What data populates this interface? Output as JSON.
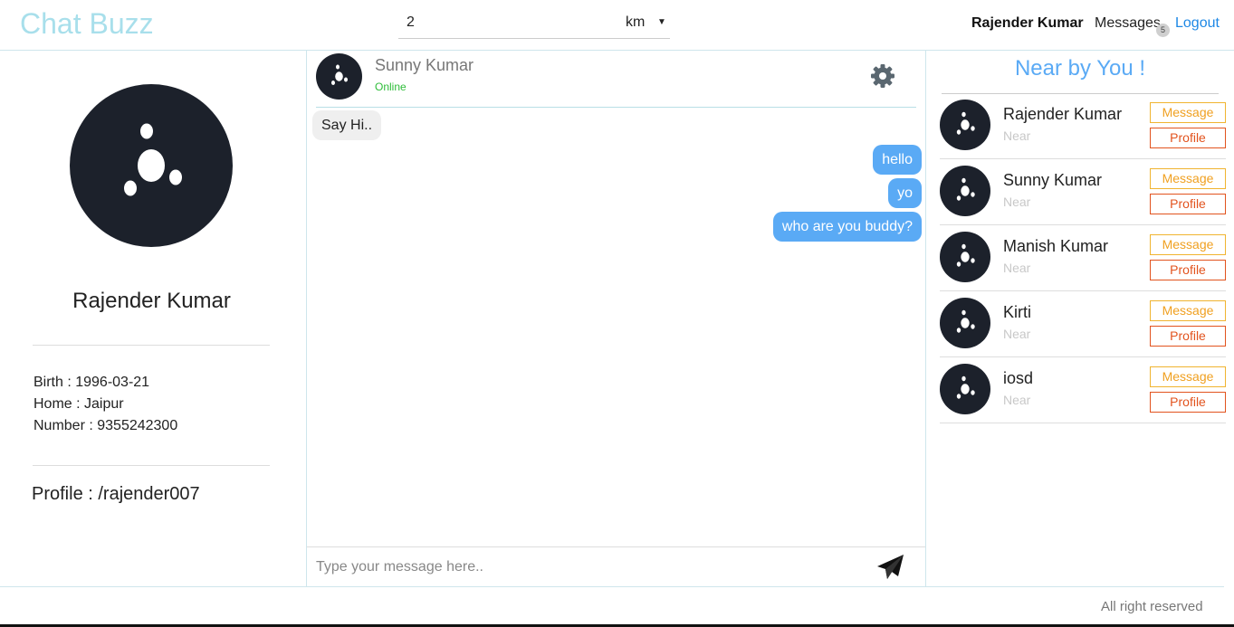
{
  "header": {
    "brand": "Chat Buzz",
    "distance_value": "2",
    "distance_unit": "km",
    "user_name": "Rajender Kumar",
    "messages_label": "Messages",
    "messages_count": "5",
    "logout_label": "Logout"
  },
  "profile": {
    "avatar_icon": "avatar-icon",
    "name": "Rajender Kumar",
    "birth": "Birth : 1996-03-21",
    "home": "Home : Jaipur",
    "number": "Number : 9355242300",
    "profile_line": "Profile : /rajender007"
  },
  "chat": {
    "contact_name": "Sunny Kumar",
    "contact_status": "Online",
    "settings_icon": "gear-icon",
    "messages": [
      {
        "text": "Say Hi..",
        "direction": "in"
      },
      {
        "text": "hello",
        "direction": "out"
      },
      {
        "text": "yo",
        "direction": "out"
      },
      {
        "text": "who are you buddy?",
        "direction": "out"
      }
    ],
    "input_placeholder": "Type your message here..",
    "send_icon": "paper-plane-icon"
  },
  "nearby": {
    "title": "Near by You !",
    "items": [
      {
        "name": "Rajender Kumar",
        "sub": "Near",
        "message_label": "Message",
        "profile_label": "Profile"
      },
      {
        "name": "Sunny Kumar",
        "sub": "Near",
        "message_label": "Message",
        "profile_label": "Profile"
      },
      {
        "name": "Manish Kumar",
        "sub": "Near",
        "message_label": "Message",
        "profile_label": "Profile"
      },
      {
        "name": "Kirti",
        "sub": "Near",
        "message_label": "Message",
        "profile_label": "Profile"
      },
      {
        "name": "iosd",
        "sub": "Near",
        "message_label": "Message",
        "profile_label": "Profile"
      }
    ]
  },
  "footer": {
    "text": "All right reserved"
  },
  "colors": {
    "brand": "#a8dfeb",
    "accent": "#5aaaf5",
    "online": "#2ebd39",
    "message_button": "#f0b430",
    "profile_button": "#e2531e"
  }
}
